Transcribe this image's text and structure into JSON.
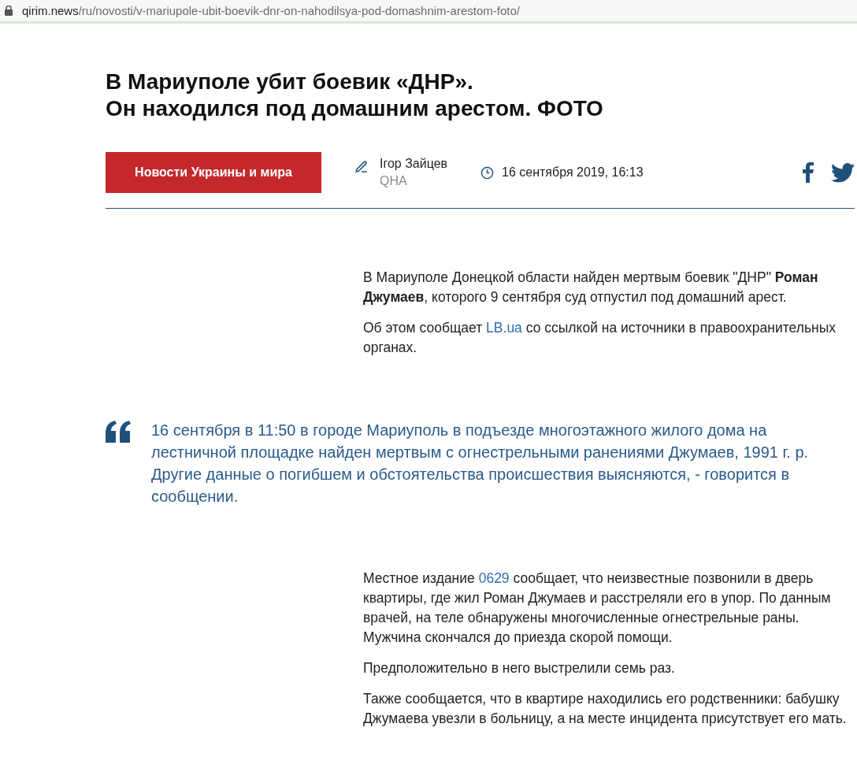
{
  "address_bar": {
    "domain": "qirim.news",
    "path": "/ru/novosti/v-mariupole-ubit-boevik-dnr-on-nahodilsya-pod-domashnim-arestom-foto/"
  },
  "article": {
    "title_lines": [
      "В Мариуполе убит боевик «ДНР».",
      "Он находился под домашним арестом. ФОТО"
    ],
    "category": "Новости Украины и мира",
    "author": "Ігор Зайцев",
    "source": "QHA",
    "date": "16 сентября 2019, 16:13",
    "blocks": [
      {
        "kind": "paragraph",
        "text": "В Мариуполе Донецкой области найден мертвым боевик \"ДНР\" **Роман Джумаев**, которого 9 сентября суд отпустил под домашний арест."
      },
      {
        "kind": "paragraph",
        "before": "Об этом сообщает",
        "link": "LB.ua",
        "after": "со ссылкой на источники в правоохранительных органах."
      },
      {
        "kind": "quote",
        "text": "16 сентября в 11:50 в городе Мариуполь в подъезде многоэтажного жилого дома на лестничной площадке найден мертвым с огнестрельными ранениями Джумаев, 1991 г. р. Другие данные о погибшем и обстоятельства происшествия выясняются, - говорится в сообщении."
      },
      {
        "kind": "paragraph",
        "before": "Местное издание",
        "link": "0629",
        "after": "сообщает, что неизвестные позвонили в дверь квартиры, где жил Роман Джумаев и расстреляли его в упор. По данным врачей, на теле обнаружены многочисленные огнестрельные раны. Мужчина скончался до приезда скорой помощи."
      },
      {
        "kind": "paragraph",
        "text": "Предположительно в него выстрелили семь раз."
      },
      {
        "kind": "paragraph",
        "text": "Также сообщается, что в квартире находились его родственники: бабушку Джумаева увезли в больницу, а на месте инцидента присутствует его мать."
      }
    ]
  }
}
